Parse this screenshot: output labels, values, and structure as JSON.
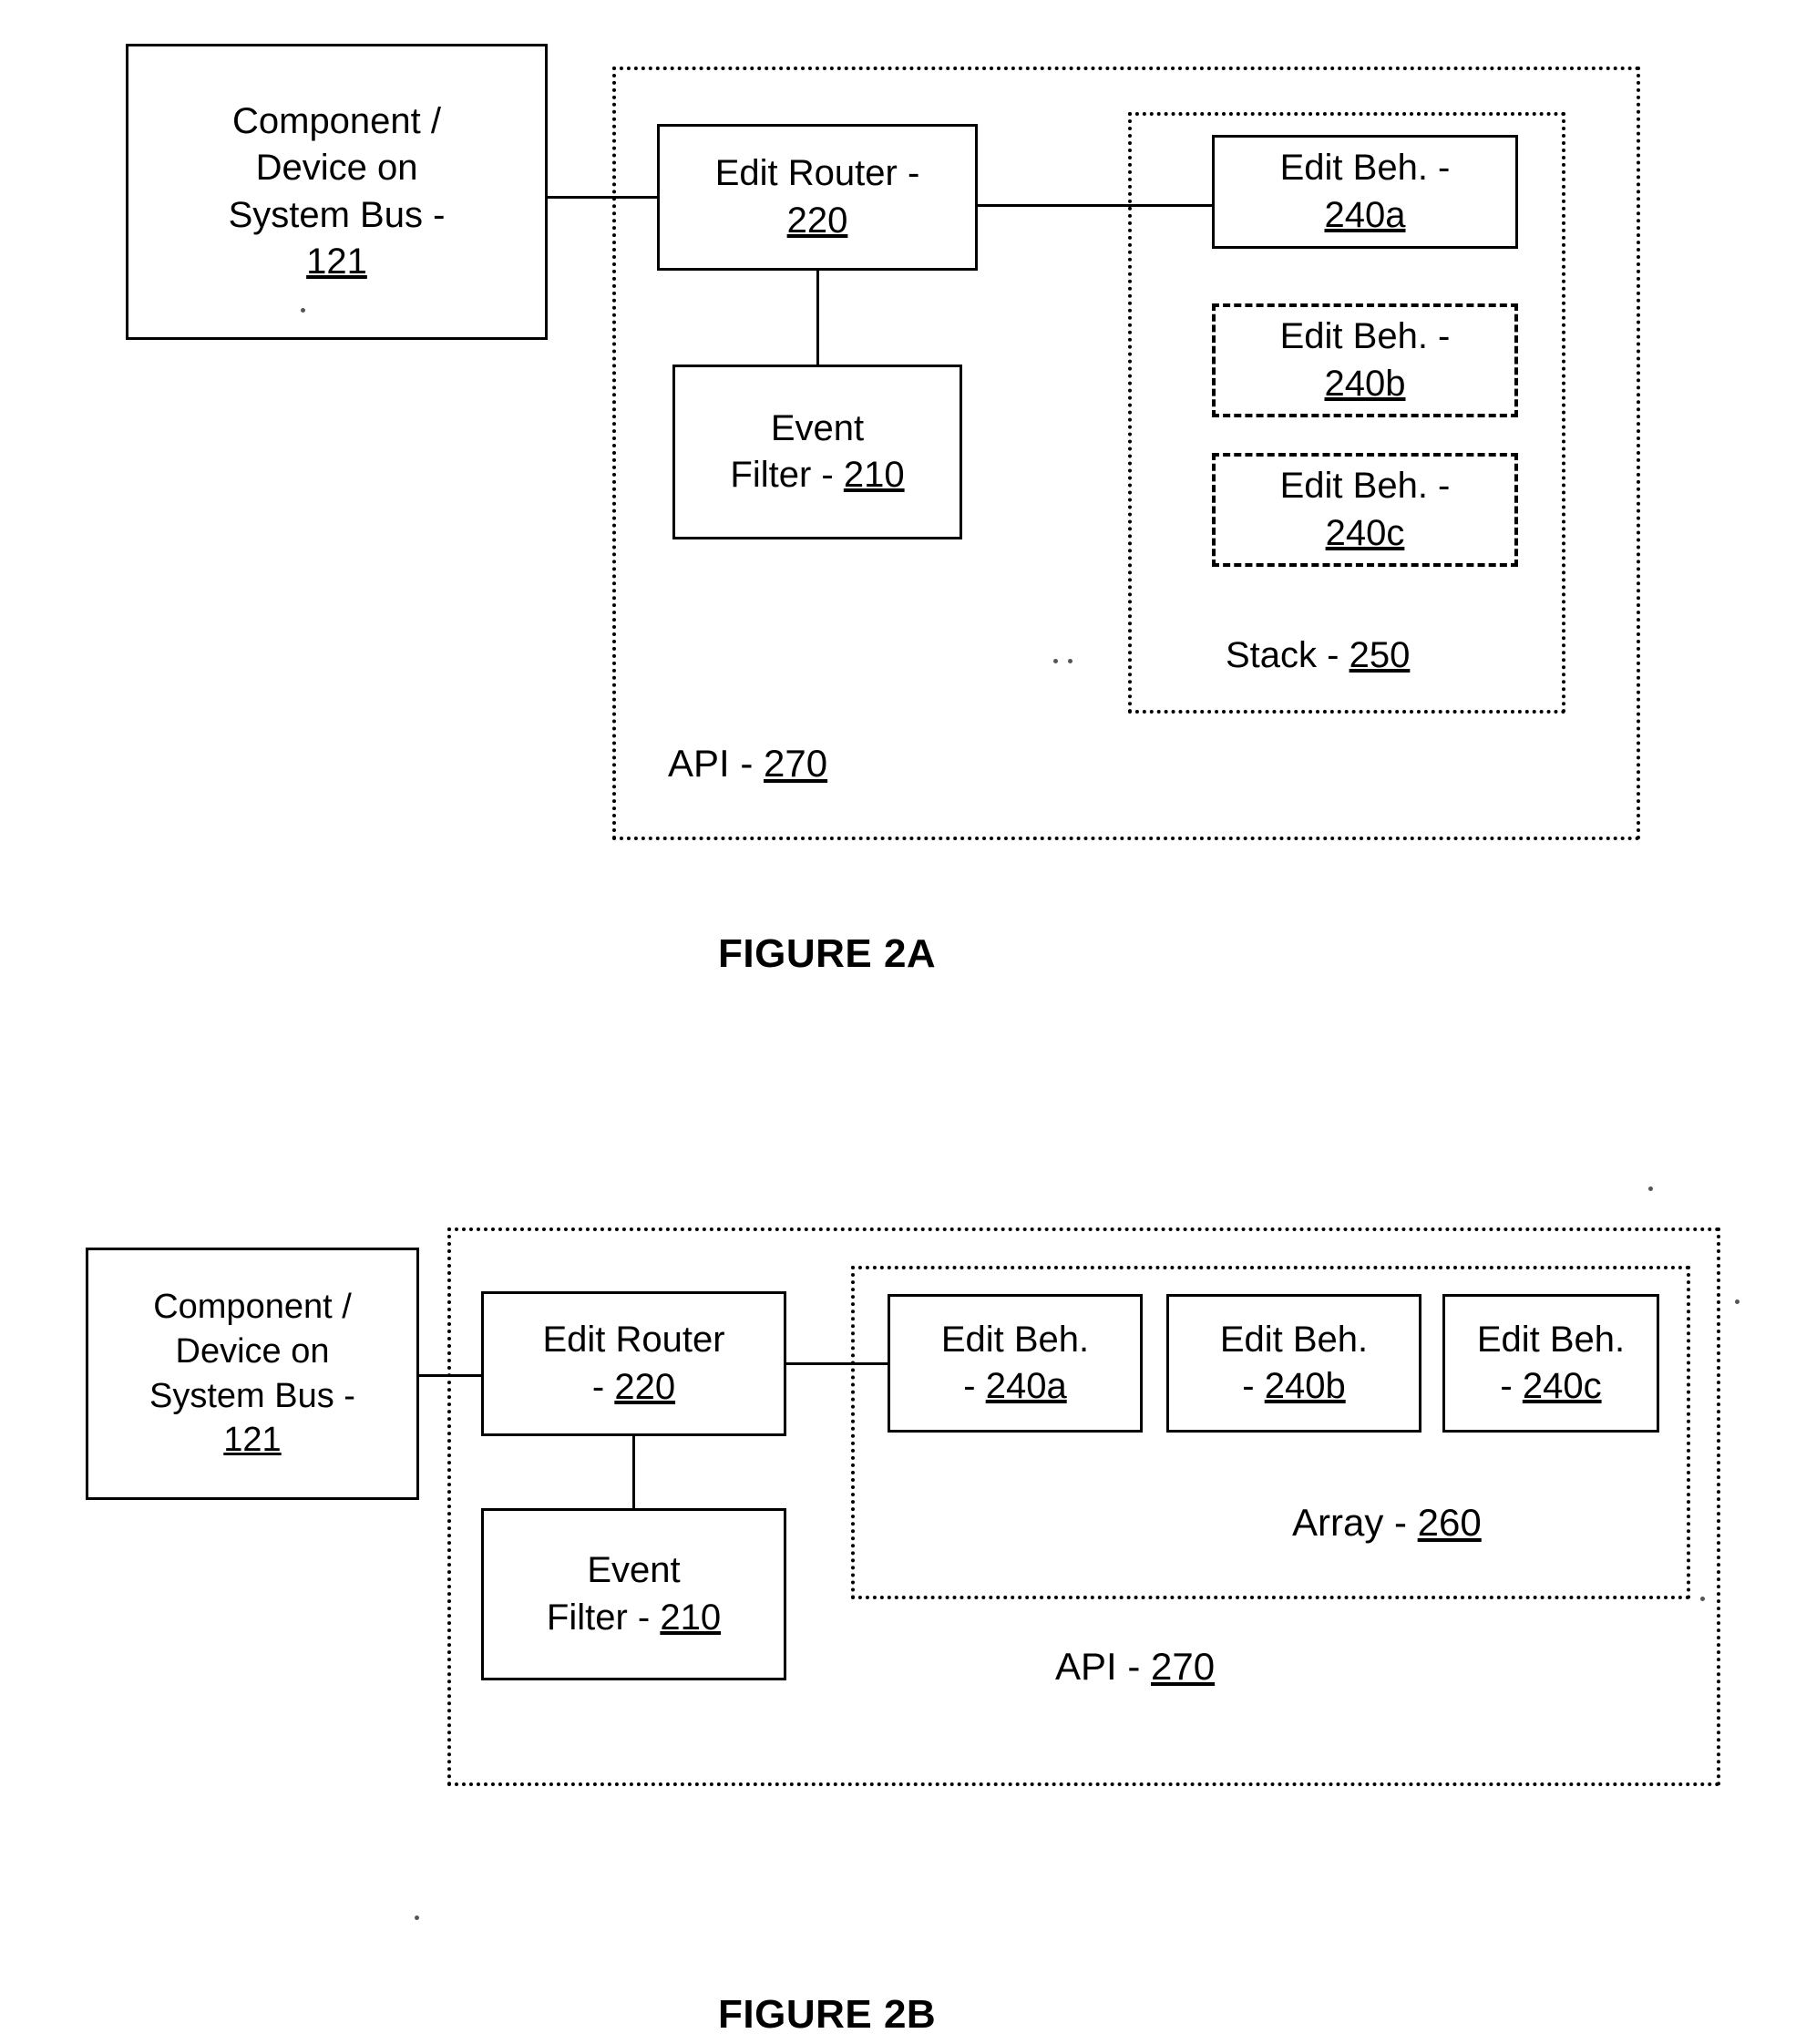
{
  "figure_2a": {
    "caption": "FIGURE 2A",
    "component_box": {
      "line1": "Component /",
      "line2": "Device on",
      "line3": "System Bus -",
      "ref": "121"
    },
    "edit_router": {
      "line1": "Edit Router -",
      "ref": "220"
    },
    "event_filter": {
      "line1": "Event",
      "line2_prefix": "Filter - ",
      "ref": "210"
    },
    "edit_behaviors": [
      {
        "line1": "Edit Beh. -",
        "ref": "240a",
        "style": "solid"
      },
      {
        "line1": "Edit Beh. -",
        "ref": "240b",
        "style": "dashed"
      },
      {
        "line1": "Edit Beh. -",
        "ref": "240c",
        "style": "dashed"
      }
    ],
    "stack_label": {
      "text": "Stack - ",
      "ref": "250"
    },
    "api_label": {
      "text": "API - ",
      "ref": "270"
    }
  },
  "figure_2b": {
    "caption": "FIGURE 2B",
    "component_box": {
      "line1": "Component /",
      "line2": "Device on",
      "line3": "System Bus -",
      "ref": "121"
    },
    "edit_router": {
      "line1": "Edit Router",
      "ref_prefix": "- ",
      "ref": "220"
    },
    "event_filter": {
      "line1": "Event",
      "line2_prefix": "Filter - ",
      "ref": "210"
    },
    "edit_behaviors": [
      {
        "line1": "Edit Beh.",
        "ref_prefix": "- ",
        "ref": "240a",
        "style": "solid"
      },
      {
        "line1": "Edit Beh.",
        "ref_prefix": "- ",
        "ref": "240b",
        "style": "solid"
      },
      {
        "line1": "Edit Beh.",
        "ref_prefix": "- ",
        "ref": "240c",
        "style": "solid"
      }
    ],
    "array_label": {
      "text": "Array - ",
      "ref": "260"
    },
    "api_label": {
      "text": "API - ",
      "ref": "270"
    }
  }
}
